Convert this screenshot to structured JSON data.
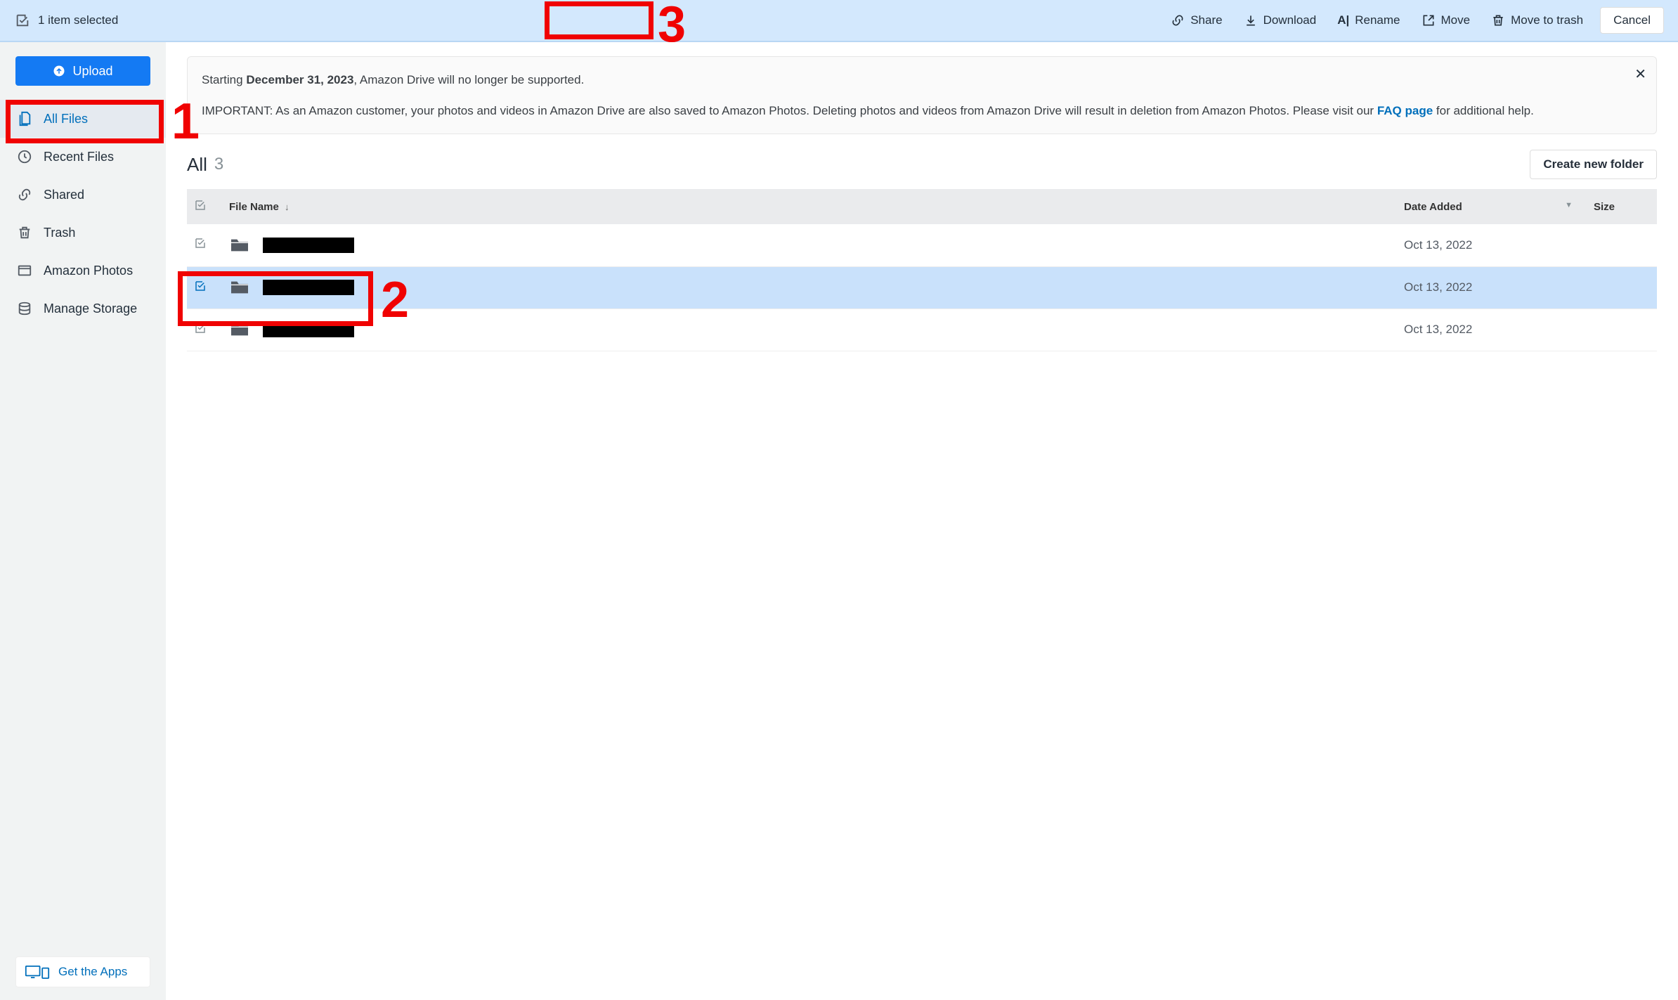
{
  "selection_bar": {
    "selected_text": "1 item selected",
    "actions": {
      "share": "Share",
      "download": "Download",
      "rename": "Rename",
      "move": "Move",
      "trash": "Move to trash"
    },
    "cancel": "Cancel"
  },
  "sidebar": {
    "upload_label": "Upload",
    "items": [
      {
        "label": "All Files",
        "key": "all-files",
        "active": true
      },
      {
        "label": "Recent Files",
        "key": "recent",
        "active": false
      },
      {
        "label": "Shared",
        "key": "shared",
        "active": false
      },
      {
        "label": "Trash",
        "key": "trash",
        "active": false
      },
      {
        "label": "Amazon Photos",
        "key": "photos",
        "active": false
      },
      {
        "label": "Manage Storage",
        "key": "storage",
        "active": false
      }
    ],
    "get_apps_label": "Get the Apps"
  },
  "notice": {
    "line1_pre": "Starting ",
    "line1_bold": "December 31, 2023",
    "line1_post": ", Amazon Drive will no longer be supported.",
    "line2_pre": "IMPORTANT: As an Amazon customer, your photos and videos in Amazon Drive are also saved to Amazon Photos. Deleting photos and videos from Amazon Drive will result in deletion from Amazon Photos. Please visit our ",
    "faq_label": "FAQ page",
    "line2_post": " for additional help."
  },
  "content_header": {
    "title": "All",
    "count": "3",
    "create_folder": "Create new folder"
  },
  "columns": {
    "name": "File Name",
    "date": "Date Added",
    "size": "Size"
  },
  "rows": [
    {
      "name": "",
      "date": "Oct 13, 2022",
      "size": "",
      "selected": false
    },
    {
      "name": "",
      "date": "Oct 13, 2022",
      "size": "",
      "selected": true
    },
    {
      "name": "",
      "date": "Oct 13, 2022",
      "size": "",
      "selected": false
    }
  ],
  "annotations": {
    "n1": "1",
    "n2": "2",
    "n3": "3"
  }
}
